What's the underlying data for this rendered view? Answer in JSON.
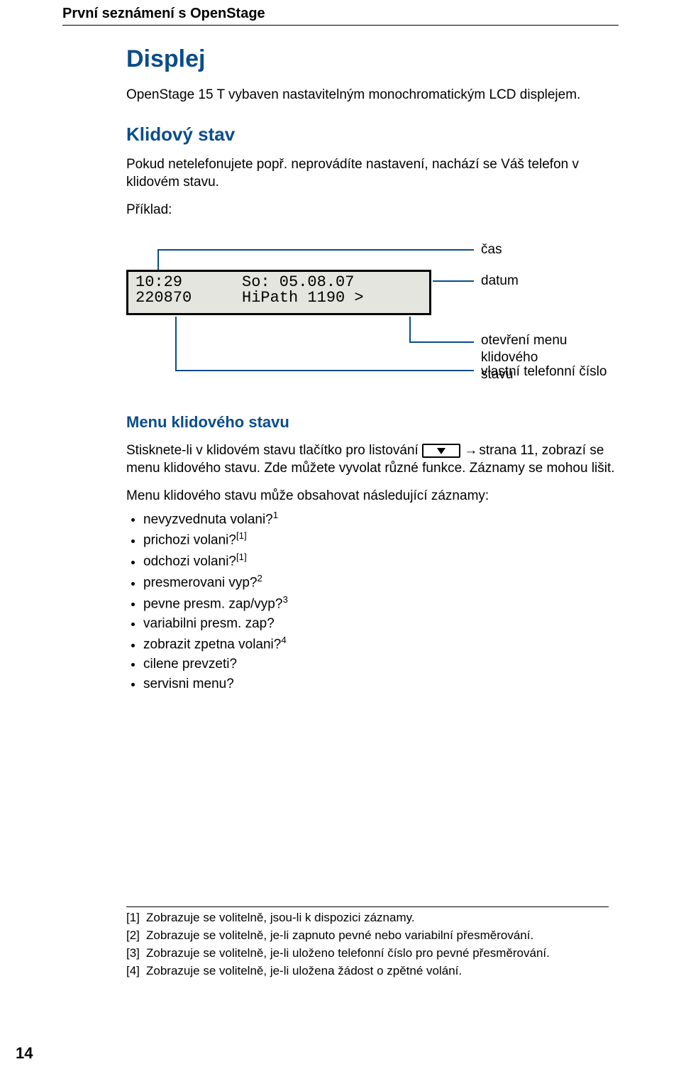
{
  "running_header": "První seznámení s OpenStage",
  "h1": "Displej",
  "p_intro": "OpenStage 15 T vybaven nastavitelným monochromatickým LCD displejem.",
  "h2_idle": "Klidový stav",
  "p_idle": "Pokud netelefonujete popř. neprovádíte nastavení, nachází se Váš telefon v klidovém stavu.",
  "p_example": "Příklad:",
  "display": {
    "time": "10:29",
    "ext": "220870",
    "date": "So: 05.08.07",
    "sys": "HiPath 1190 >"
  },
  "callouts": {
    "time": "čas",
    "date": "datum",
    "menu": "otevření menu klidového\nstavu",
    "ext": "vlastní telefonní číslo"
  },
  "h3_menu": "Menu klidového stavu",
  "p_menu_pre": "Stisknete-li v klidovém stavu tlačítko pro listování ",
  "crossref": " strana 11",
  "p_menu_post": ", zobrazí se menu klidového stavu. Zde můžete vyvolat různé funkce. Záznamy se mohou lišit.",
  "p_list_intro": "Menu klidového stavu může obsahovat následující záznamy:",
  "items": [
    {
      "text": "nevyzvednuta volani?",
      "sup": "1"
    },
    {
      "text": "prichozi volani?",
      "sup": "[1]"
    },
    {
      "text": "odchozi volani?",
      "sup": "[1]"
    },
    {
      "text": "presmerovani vyp?",
      "sup": "2"
    },
    {
      "text": "pevne presm. zap/vyp?",
      "sup": "3"
    },
    {
      "text": "variabilni presm. zap?",
      "sup": ""
    },
    {
      "text": "zobrazit zpetna volani?",
      "sup": "4"
    },
    {
      "text": "cilene prevzeti?",
      "sup": ""
    },
    {
      "text": "servisni menu?",
      "sup": ""
    }
  ],
  "footnotes": [
    {
      "n": "[1]",
      "t": "Zobrazuje se volitelně, jsou-li k dispozici záznamy."
    },
    {
      "n": "[2]",
      "t": "Zobrazuje se volitelně, je-li zapnuto pevné nebo variabilní přesměrování."
    },
    {
      "n": "[3]",
      "t": "Zobrazuje se volitelně, je-li uloženo telefonní číslo pro pevné přesměrování."
    },
    {
      "n": "[4]",
      "t": "Zobrazuje se volitelně, je-li uložena žádost o zpětné volání."
    }
  ],
  "page_number": "14"
}
